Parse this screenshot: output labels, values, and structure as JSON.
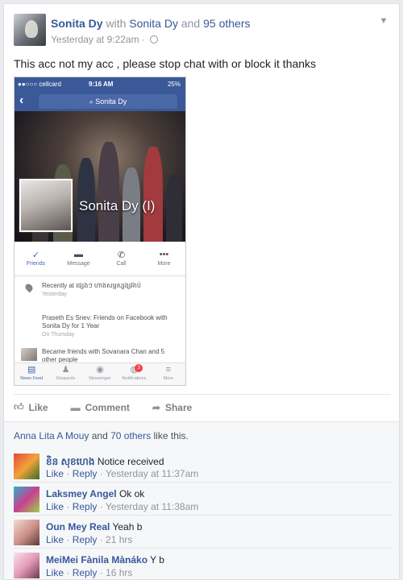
{
  "post": {
    "author": "Sonita Dy",
    "with_text": "with",
    "tagged": "Sonita Dy",
    "and_text": "and",
    "others": "95 others",
    "time": "Yesterday at 9:22am",
    "separator": "·",
    "text": "This acc not my acc , please stop chat with or block it thanks"
  },
  "phone": {
    "carrier": "●●○○○ cellcard",
    "clock": "9:16 AM",
    "battery": "25%",
    "search_label": "Sonita Dy",
    "profile_name": "Sonita Dy (I)",
    "actions": [
      "Friends",
      "Message",
      "Call",
      "More"
    ],
    "recent_label": "Recently at",
    "recent_place": "ផ្សេងៗ ហាងសម្ពស្សង្សអ៊ាប់",
    "recent_sub": "Yesterday",
    "friends_text": "Praseth Es Snev: Friends on Facebook with Sonita Dy for 1 Year",
    "friends_sub": "On Thursday",
    "became_text": "Became friends with Sovanara Chan and 5 other people",
    "tabs": [
      "News Feed",
      "Requests",
      "Messenger",
      "Notifications",
      "More"
    ],
    "notification_count": "3"
  },
  "actions": {
    "like": "Like",
    "comment": "Comment",
    "share": "Share"
  },
  "likes": {
    "first": "Anna Lita A Mouy",
    "and": "and",
    "others": "70 others",
    "suffix": "like this."
  },
  "comments": [
    {
      "name": "ខិន សុខហេង",
      "text": "Notice received",
      "like": "Like",
      "reply": "Reply",
      "time": "Yesterday at 11:37am"
    },
    {
      "name": "Laksmey Angel",
      "text": "Ok ok",
      "like": "Like",
      "reply": "Reply",
      "time": "Yesterday at 11:38am"
    },
    {
      "name": "Oun Mey Real",
      "text": "Yeah b",
      "like": "Like",
      "reply": "Reply",
      "time": "21 hrs"
    },
    {
      "name": "MeiMei Fànila Mànáko",
      "text": "Y b",
      "like": "Like",
      "reply": "Reply",
      "time": "16 hrs"
    }
  ],
  "colors": {
    "link": "#365899",
    "facebook_blue": "#3b5998",
    "muted": "#90949c"
  }
}
